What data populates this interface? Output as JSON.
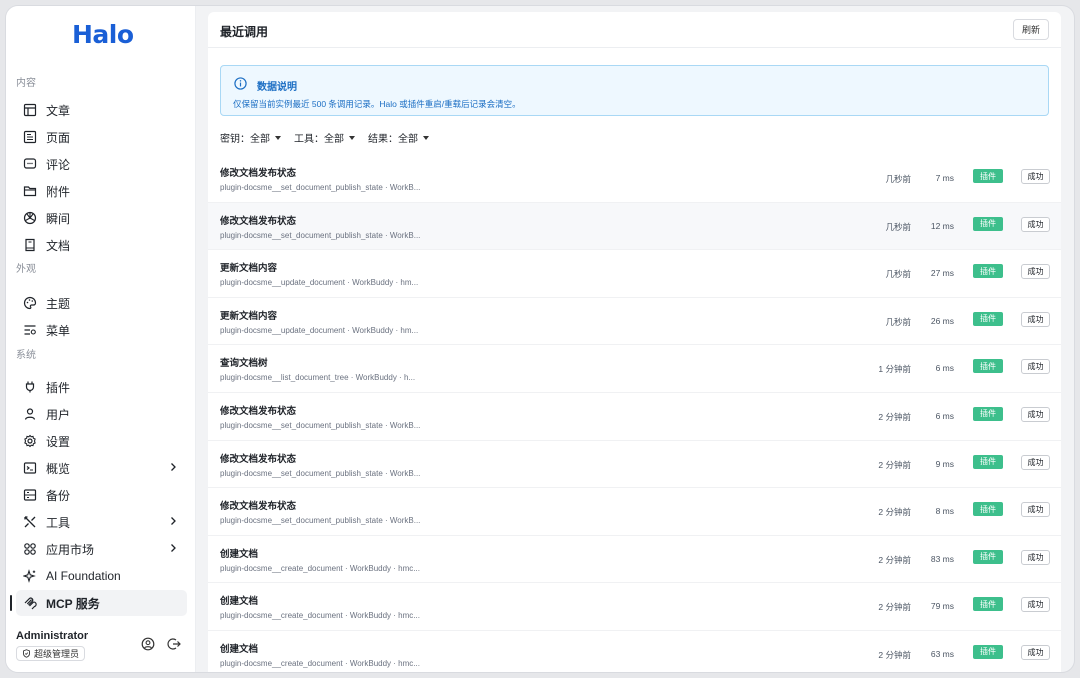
{
  "brand": {
    "logo_text": "Halo",
    "logo_color": "#1a5fd6"
  },
  "sidebar": {
    "groups": [
      {
        "label": "内容",
        "items": [
          {
            "label": "文章",
            "icon": "article-icon"
          },
          {
            "label": "页面",
            "icon": "page-icon"
          },
          {
            "label": "评论",
            "icon": "comment-icon"
          },
          {
            "label": "附件",
            "icon": "folder-icon"
          },
          {
            "label": "瞬间",
            "icon": "moment-icon"
          },
          {
            "label": "文档",
            "icon": "book-icon"
          }
        ]
      },
      {
        "label": "外观",
        "items": [
          {
            "label": "主题",
            "icon": "palette-icon"
          },
          {
            "label": "菜单",
            "icon": "menu-icon"
          }
        ]
      },
      {
        "label": "系统",
        "items": [
          {
            "label": "插件",
            "icon": "plug-icon"
          },
          {
            "label": "用户",
            "icon": "user-icon"
          },
          {
            "label": "设置",
            "icon": "settings-icon"
          },
          {
            "label": "概览",
            "icon": "terminal-icon",
            "expandable": true
          },
          {
            "label": "备份",
            "icon": "backup-icon"
          },
          {
            "label": "工具",
            "icon": "tools-icon",
            "expandable": true
          },
          {
            "label": "应用市场",
            "icon": "apps-icon",
            "expandable": true
          },
          {
            "label": "AI Foundation",
            "icon": "sparkle-icon"
          },
          {
            "label": "MCP 服务",
            "icon": "mcp-icon",
            "active": true
          }
        ]
      }
    ]
  },
  "user": {
    "name": "Administrator",
    "role": "超级管理员"
  },
  "main": {
    "title": "最近调用",
    "refresh_label": "刷新",
    "notice": {
      "title": "数据说明",
      "body": "仅保留当前实例最近 500 条调用记录。Halo 或插件重启/重载后记录会清空。"
    },
    "filters": [
      {
        "label": "密钥：",
        "value": "全部"
      },
      {
        "label": "工具：",
        "value": "全部"
      },
      {
        "label": "结果：",
        "value": "全部"
      }
    ],
    "rows": [
      {
        "title": "修改文档发布状态",
        "sub": "plugin-docsme__set_document_publish_state · WorkB...",
        "time": "几秒前",
        "duration": "7 ms",
        "type": "插件",
        "status": "成功"
      },
      {
        "title": "修改文档发布状态",
        "sub": "plugin-docsme__set_document_publish_state · WorkB...",
        "time": "几秒前",
        "duration": "12 ms",
        "type": "插件",
        "status": "成功"
      },
      {
        "title": "更新文档内容",
        "sub": "plugin-docsme__update_document · WorkBuddy · hm...",
        "time": "几秒前",
        "duration": "27 ms",
        "type": "插件",
        "status": "成功"
      },
      {
        "title": "更新文档内容",
        "sub": "plugin-docsme__update_document · WorkBuddy · hm...",
        "time": "几秒前",
        "duration": "26 ms",
        "type": "插件",
        "status": "成功"
      },
      {
        "title": "查询文档树",
        "sub": "plugin-docsme__list_document_tree · WorkBuddy · h...",
        "time": "1 分钟前",
        "duration": "6 ms",
        "type": "插件",
        "status": "成功"
      },
      {
        "title": "修改文档发布状态",
        "sub": "plugin-docsme__set_document_publish_state · WorkB...",
        "time": "2 分钟前",
        "duration": "6 ms",
        "type": "插件",
        "status": "成功"
      },
      {
        "title": "修改文档发布状态",
        "sub": "plugin-docsme__set_document_publish_state · WorkB...",
        "time": "2 分钟前",
        "duration": "9 ms",
        "type": "插件",
        "status": "成功"
      },
      {
        "title": "修改文档发布状态",
        "sub": "plugin-docsme__set_document_publish_state · WorkB...",
        "time": "2 分钟前",
        "duration": "8 ms",
        "type": "插件",
        "status": "成功"
      },
      {
        "title": "创建文档",
        "sub": "plugin-docsme__create_document · WorkBuddy · hmc...",
        "time": "2 分钟前",
        "duration": "83 ms",
        "type": "插件",
        "status": "成功"
      },
      {
        "title": "创建文档",
        "sub": "plugin-docsme__create_document · WorkBuddy · hmc...",
        "time": "2 分钟前",
        "duration": "79 ms",
        "type": "插件",
        "status": "成功"
      },
      {
        "title": "创建文档",
        "sub": "plugin-docsme__create_document · WorkBuddy · hmc...",
        "time": "2 分钟前",
        "duration": "63 ms",
        "type": "插件",
        "status": "成功"
      }
    ]
  },
  "colors": {
    "accent_green": "#3dbf8c",
    "info_blue": "#1d6fc4",
    "info_bg": "#eef8ff"
  }
}
